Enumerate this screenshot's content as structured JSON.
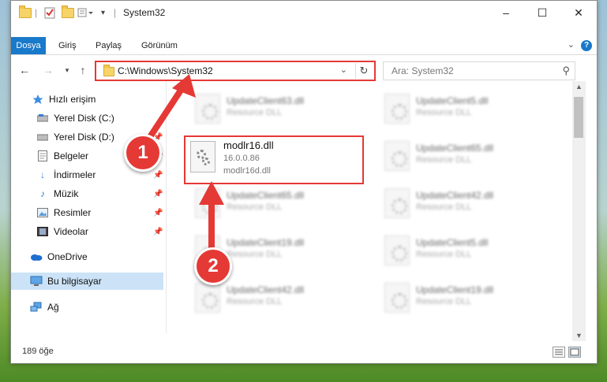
{
  "window": {
    "title": "System32",
    "minimize_glyph": "–",
    "maximize_glyph": "☐",
    "close_glyph": "✕"
  },
  "ribbon": {
    "tabs": [
      {
        "label": "Dosya"
      },
      {
        "label": "Giriş"
      },
      {
        "label": "Paylaş"
      },
      {
        "label": "Görünüm"
      }
    ],
    "help_glyph": "?"
  },
  "nav": {
    "address": "C:\\Windows\\System32",
    "search_placeholder": "Ara: System32"
  },
  "sidebar": {
    "items": [
      {
        "label": "Hızlı erişim",
        "icon": "star-icon"
      },
      {
        "label": "Yerel Disk (C:)",
        "icon": "drive-icon"
      },
      {
        "label": "Yerel Disk (D:)",
        "icon": "drive-icon"
      },
      {
        "label": "Belgeler",
        "icon": "documents-icon"
      },
      {
        "label": "İndirmeler",
        "icon": "download-icon"
      },
      {
        "label": "Müzik",
        "icon": "music-icon"
      },
      {
        "label": "Resimler",
        "icon": "pictures-icon"
      },
      {
        "label": "Videolar",
        "icon": "video-icon"
      },
      {
        "label": "OneDrive",
        "icon": "cloud-icon"
      },
      {
        "label": "Bu bilgisayar",
        "icon": "computer-icon"
      },
      {
        "label": "Ağ",
        "icon": "network-icon"
      }
    ]
  },
  "files": {
    "selected": {
      "name": "modlr16.dll",
      "version": "16.0.0.86",
      "filename": "modlr16d.dll"
    },
    "blurred": [
      {
        "name": "UpdateClient63.dll",
        "type": "Resource DLL"
      },
      {
        "name": "UpdateClient5.dll",
        "type": "Resource DLL"
      },
      {
        "name": "UpdateClient65.dll",
        "type": "Resource DLL"
      },
      {
        "name": "UpdateClient65.dll",
        "type": "Resource DLL"
      },
      {
        "name": "UpdateClient42.dll",
        "type": "Resource DLL"
      },
      {
        "name": "UpdateClient19.dll",
        "type": "Resource DLL"
      },
      {
        "name": "UpdateClient5.dll",
        "type": "Resource DLL"
      },
      {
        "name": "UpdateClient42.dll",
        "type": "Resource DLL"
      },
      {
        "name": "UpdateClient19.dll",
        "type": "Resource DLL"
      }
    ]
  },
  "status": {
    "item_count": "189 öğe"
  },
  "annotations": {
    "step1": "1",
    "step2": "2"
  },
  "colors": {
    "accent": "#1979ca",
    "highlight": "#e53935",
    "selected_nav": "#cce3f7"
  }
}
